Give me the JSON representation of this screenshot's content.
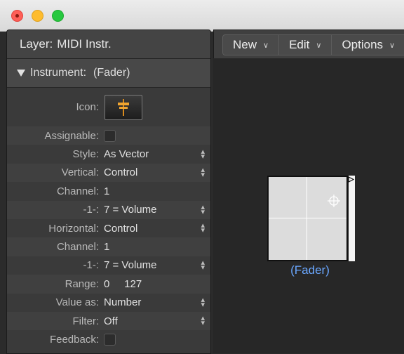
{
  "window": {
    "traffic_lights": {
      "close": "#fe5f57",
      "minimize": "#febc2e",
      "zoom": "#28c840"
    }
  },
  "inspector": {
    "layer_label": "Layer:",
    "layer_value": "MIDI Instr.",
    "section_title": "Instrument:",
    "section_subtitle": "(Fader)",
    "rows": [
      {
        "label": "Icon:",
        "kind": "icon",
        "icon": "fader-icon"
      },
      {
        "label": "Assignable:",
        "kind": "checkbox",
        "checked": false
      },
      {
        "label": "Style:",
        "value": "As Vector",
        "stepper": true
      },
      {
        "label": "Vertical:",
        "value": "Control",
        "stepper": true
      },
      {
        "label": "Channel:",
        "value": "1",
        "stepper": false
      },
      {
        "label": "-1-:",
        "value": "7 = Volume",
        "stepper": true
      },
      {
        "label": "Horizontal:",
        "value": "Control",
        "stepper": true
      },
      {
        "label": "Channel:",
        "value": "1",
        "stepper": false
      },
      {
        "label": "-1-:",
        "value": "7 = Volume",
        "stepper": true
      },
      {
        "label": "Range:",
        "value": "0     127",
        "stepper": false
      },
      {
        "label": "Value as:",
        "value": "Number",
        "stepper": true
      },
      {
        "label": "Filter:",
        "value": "Off",
        "stepper": true
      },
      {
        "label": "Feedback:",
        "kind": "checkbox",
        "checked": false
      }
    ]
  },
  "toolbar": {
    "menus": [
      "New",
      "Edit",
      "Options"
    ]
  },
  "canvas": {
    "object_label": "(Fader)",
    "label_color": "#6aa7ff"
  }
}
